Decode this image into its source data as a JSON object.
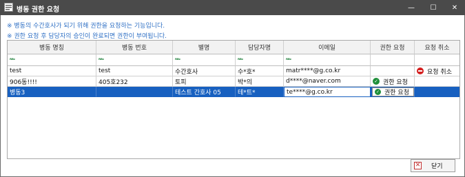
{
  "window": {
    "title": "병동 권한 요청",
    "minimize_glyph": "—",
    "maximize_glyph": "☐",
    "close_glyph": "✕"
  },
  "notices": [
    "※ 병동의 수간호사가 되기 위해 권한을 요청하는 기능입니다.",
    "※ 권한 요청 후 담당자의 승인이 완료되면 권한이 부여됩니다."
  ],
  "grid": {
    "columns": [
      "병동 명칭",
      "병동 번호",
      "별명",
      "담당자명",
      "이메일",
      "권한 요청",
      "요청 취소"
    ],
    "filter_icon_text": "ᴿᴮᶜ",
    "rows": [
      {
        "ward_name": "test",
        "ward_no": "test",
        "nickname": "수간호사",
        "manager": "수*호*",
        "email": "matr****@g.co.kr",
        "request": "",
        "cancel": "요청 취소"
      },
      {
        "ward_name": "906동!!!!",
        "ward_no": "405호232",
        "nickname": "토피",
        "manager": "박*의",
        "email": "d****@naver.com",
        "request": "권한 요청",
        "cancel": ""
      },
      {
        "ward_name": "병동3",
        "ward_no": "",
        "nickname": "테스트 간호사 05",
        "manager": "테*트*",
        "email": "te****@g.co.kr",
        "request": "권한 요청",
        "cancel": ""
      }
    ]
  },
  "footer": {
    "close_label": "닫기"
  },
  "icons": {
    "app": "ward-app-icon",
    "request": "check-circle-icon",
    "cancel": "no-entry-icon",
    "close": "x-box-icon"
  },
  "colors": {
    "titlebar": "#4a4a4a",
    "notice": "#2e6fc4",
    "selection": "#1760c0",
    "ok": "#1f8f3a",
    "cancel": "#d41f1f"
  }
}
